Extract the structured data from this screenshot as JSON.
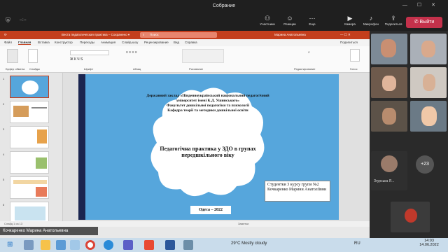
{
  "meeting": {
    "title": "Собрание",
    "timer": "--:--"
  },
  "toolbar": {
    "participants": "Участники",
    "reactions": "Реакции",
    "more": "Еще",
    "camera": "Камера",
    "mic": "Микрофон",
    "share": "Поделиться",
    "leave": "Выйти"
  },
  "powerpoint": {
    "titlebar": "Веста педагогическая практика – Сохранено ▾",
    "search": "Поиск",
    "user": "Марина Анатольевна",
    "share_btn": "Поделиться",
    "tabs": [
      "Файл",
      "Главная",
      "Вставка",
      "Конструктор",
      "Переходы",
      "Анимация",
      "Слайд-шоу",
      "Рецензирование",
      "Вид",
      "Справка"
    ],
    "ribbon_groups": [
      "Буфер обмена",
      "Слайды",
      "Шрифт",
      "Абзац",
      "Рисование",
      "Редактирование",
      "Голос"
    ],
    "slide_numbers": [
      "1",
      "2",
      "3",
      "4",
      "5",
      "6"
    ],
    "status_left": "Слайд 1 из 13",
    "status_right": "Заметки"
  },
  "slide": {
    "institution": "Державний заклад «Південноукраїнський національний педагогічний університет імені К.Д. Ушинського»",
    "faculty": "Факультет дошкільної педагогіки та психології",
    "department": "Кафедра теорії та методики дошкільної освіти",
    "topic": "Педагогічна практика у ЗДО в групах передшкільного віку",
    "author": "Студентки 3 курсу групи №2 Кочкаренко Марини Анатоліївни",
    "city_year": "Одеса – 2022"
  },
  "presenter": {
    "name": "Кочкаренко Марина Анатольевна"
  },
  "participants": {
    "named_tile": "Згурська Я...",
    "more_count": "+23"
  },
  "taskbar": {
    "weather": "29°C  Mostly cloudy",
    "lang": "RU",
    "time": "14:03",
    "date": "14.06.2022"
  }
}
